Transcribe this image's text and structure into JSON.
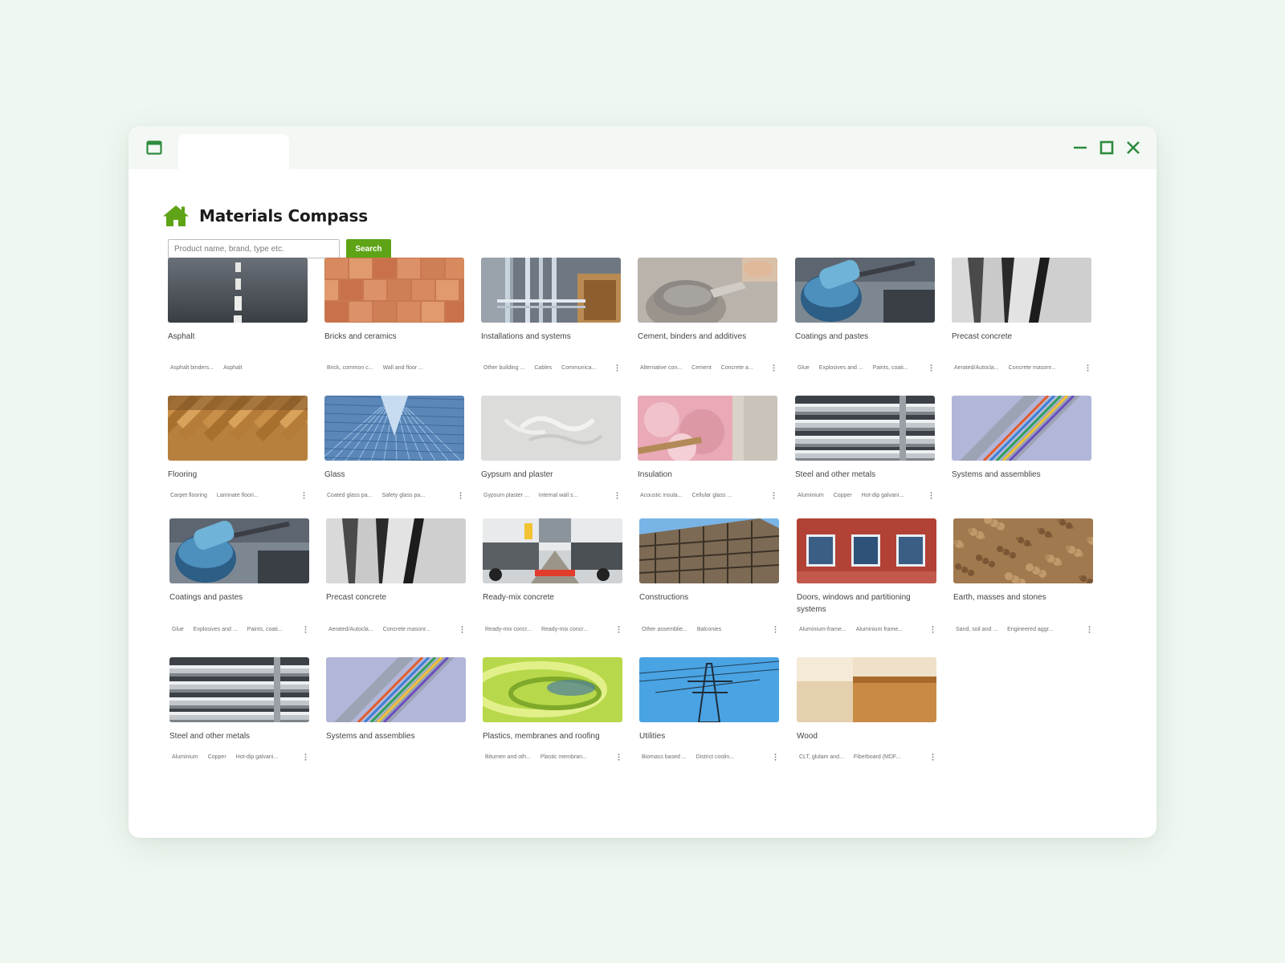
{
  "app": {
    "title": "Materials Compass",
    "accent_color": "#5ea416",
    "window_controls_color": "#2e8b3e"
  },
  "search": {
    "placeholder": "Product name, brand, type etc.",
    "value": "",
    "button_label": "Search"
  },
  "categories": [
    {
      "title": "Asphalt",
      "tags": [
        "Asphalt binders...",
        "Asphalt"
      ],
      "more": false,
      "image": "asphalt"
    },
    {
      "title": "Bricks and ceramics",
      "tags": [
        "Brick, common c...",
        "Wall and floor ..."
      ],
      "more": false,
      "image": "bricks"
    },
    {
      "title": "Installations and systems",
      "tags": [
        "Other building ...",
        "Cables",
        "Communica..."
      ],
      "more": true,
      "image": "installations"
    },
    {
      "title": "Cement, binders and additives",
      "tags": [
        "Alternative con...",
        "Cement",
        "Concrete a..."
      ],
      "more": true,
      "image": "cement"
    },
    {
      "title": "Coatings and pastes",
      "tags": [
        "Glue",
        "Explosives and ...",
        "Paints, coati..."
      ],
      "more": true,
      "image": "coatings"
    },
    {
      "title": "Precast concrete",
      "tags": [
        "Aerated/Autocla...",
        "Concrete masonr..."
      ],
      "more": true,
      "image": "precast"
    },
    {
      "title": "Flooring",
      "tags": [
        "Carpet flooring",
        "Laminate floori..."
      ],
      "more": true,
      "image": "flooring"
    },
    {
      "title": "Glass",
      "tags": [
        "Coated glass pa...",
        "Safety glass pa..."
      ],
      "more": true,
      "image": "glass"
    },
    {
      "title": "Gypsum and plaster",
      "tags": [
        "Gypsum plaster ...",
        "Internal wall s..."
      ],
      "more": true,
      "image": "gypsum"
    },
    {
      "title": "Insulation",
      "tags": [
        "Acoustic insula...",
        "Cellular glass ..."
      ],
      "more": true,
      "image": "insulation"
    },
    {
      "title": "Steel and other metals",
      "tags": [
        "Aluminium",
        "Copper",
        "Hot-dip galvani..."
      ],
      "more": true,
      "image": "steel"
    },
    {
      "title": "Systems and assemblies",
      "tags": [],
      "more": false,
      "image": "systems"
    },
    {
      "title": "Coatings and pastes",
      "tags": [
        "Glue",
        "Explosives and ...",
        "Paints, coati..."
      ],
      "more": true,
      "image": "coatings"
    },
    {
      "title": "Precast concrete",
      "tags": [
        "Aerated/Autocla...",
        "Concrete masonr..."
      ],
      "more": true,
      "image": "precast"
    },
    {
      "title": "Ready-mix concrete",
      "tags": [
        "Ready-mix concr...",
        "Ready-mix concr..."
      ],
      "more": true,
      "image": "readymix"
    },
    {
      "title": "Constructions",
      "tags": [
        "Other assemblie...",
        "Balconies"
      ],
      "more": true,
      "image": "constructions"
    },
    {
      "title": "Doors, windows and partitioning systems",
      "tags": [
        "Aluminium-frame...",
        "Aluminium frame..."
      ],
      "more": true,
      "image": "doors"
    },
    {
      "title": "Earth, masses and stones",
      "tags": [
        "Sand, soil and ...",
        "Engineered aggr..."
      ],
      "more": true,
      "image": "earth"
    },
    {
      "title": "Steel and other metals",
      "tags": [
        "Aluminium",
        "Copper",
        "Hot-dip galvani..."
      ],
      "more": true,
      "image": "steel"
    },
    {
      "title": "Systems and assemblies",
      "tags": [],
      "more": false,
      "image": "systems"
    },
    {
      "title": "Plastics, membranes and roofing",
      "tags": [
        "Bitumen and oth...",
        "Plastic membran..."
      ],
      "more": true,
      "image": "plastics"
    },
    {
      "title": "Utilities",
      "tags": [
        "Biomass based ...",
        "District coolin..."
      ],
      "more": true,
      "image": "utilities"
    },
    {
      "title": "Wood",
      "tags": [
        "CLT, glulam and...",
        "Fiberboard (MDF..."
      ],
      "more": true,
      "image": "wood"
    }
  ]
}
